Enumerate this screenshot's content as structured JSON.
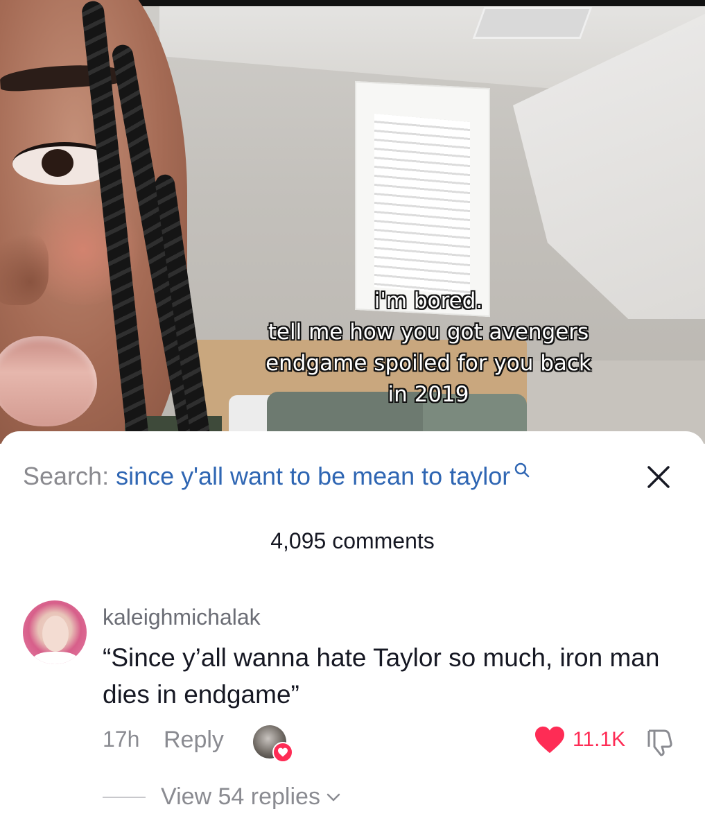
{
  "video": {
    "caption_lines": [
      "i'm bored.",
      "tell me how you got avengers",
      "endgame spoiled for you back",
      "in 2019"
    ]
  },
  "search": {
    "label": "Search:",
    "query": "since y'all want to be mean to taylor",
    "icon": "search-icon"
  },
  "close": {
    "icon": "close-icon"
  },
  "comments": {
    "count_label": "4,095 comments"
  },
  "comment": {
    "username": "kaleighmichalak",
    "text": "“Since y’all wanna hate Taylor so much, iron man dies in endgame”",
    "time": "17h",
    "reply_label": "Reply",
    "like_count": "11.1K",
    "liked": true,
    "liked_by_creator": true,
    "view_replies_label": "View 54 replies"
  },
  "colors": {
    "accent_like": "#fe2c55",
    "search_query": "#2f66b3",
    "muted_text": "#8a8b91",
    "primary_text": "#161823"
  }
}
